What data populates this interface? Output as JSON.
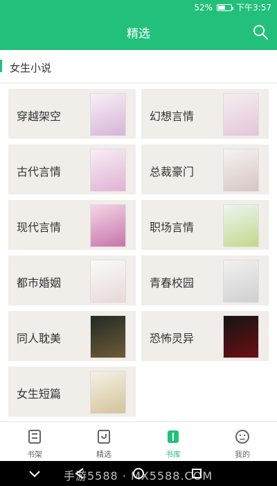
{
  "status_bar": {
    "battery": "52%",
    "time": "下午3:57"
  },
  "header": {
    "title": "精选"
  },
  "section": {
    "title": "女生小说"
  },
  "categories": [
    {
      "label": "穿越架空"
    },
    {
      "label": "幻想言情"
    },
    {
      "label": "古代言情"
    },
    {
      "label": "总裁豪门"
    },
    {
      "label": "现代言情"
    },
    {
      "label": "职场言情"
    },
    {
      "label": "都市婚姻"
    },
    {
      "label": "青春校园"
    },
    {
      "label": "同人耽美"
    },
    {
      "label": "恐怖灵异"
    },
    {
      "label": "女生短篇"
    }
  ],
  "bottom_nav": [
    {
      "label": "书架"
    },
    {
      "label": "精选"
    },
    {
      "label": "书库"
    },
    {
      "label": "我的"
    }
  ],
  "watermark": "手游5588 · MX5588.COM"
}
